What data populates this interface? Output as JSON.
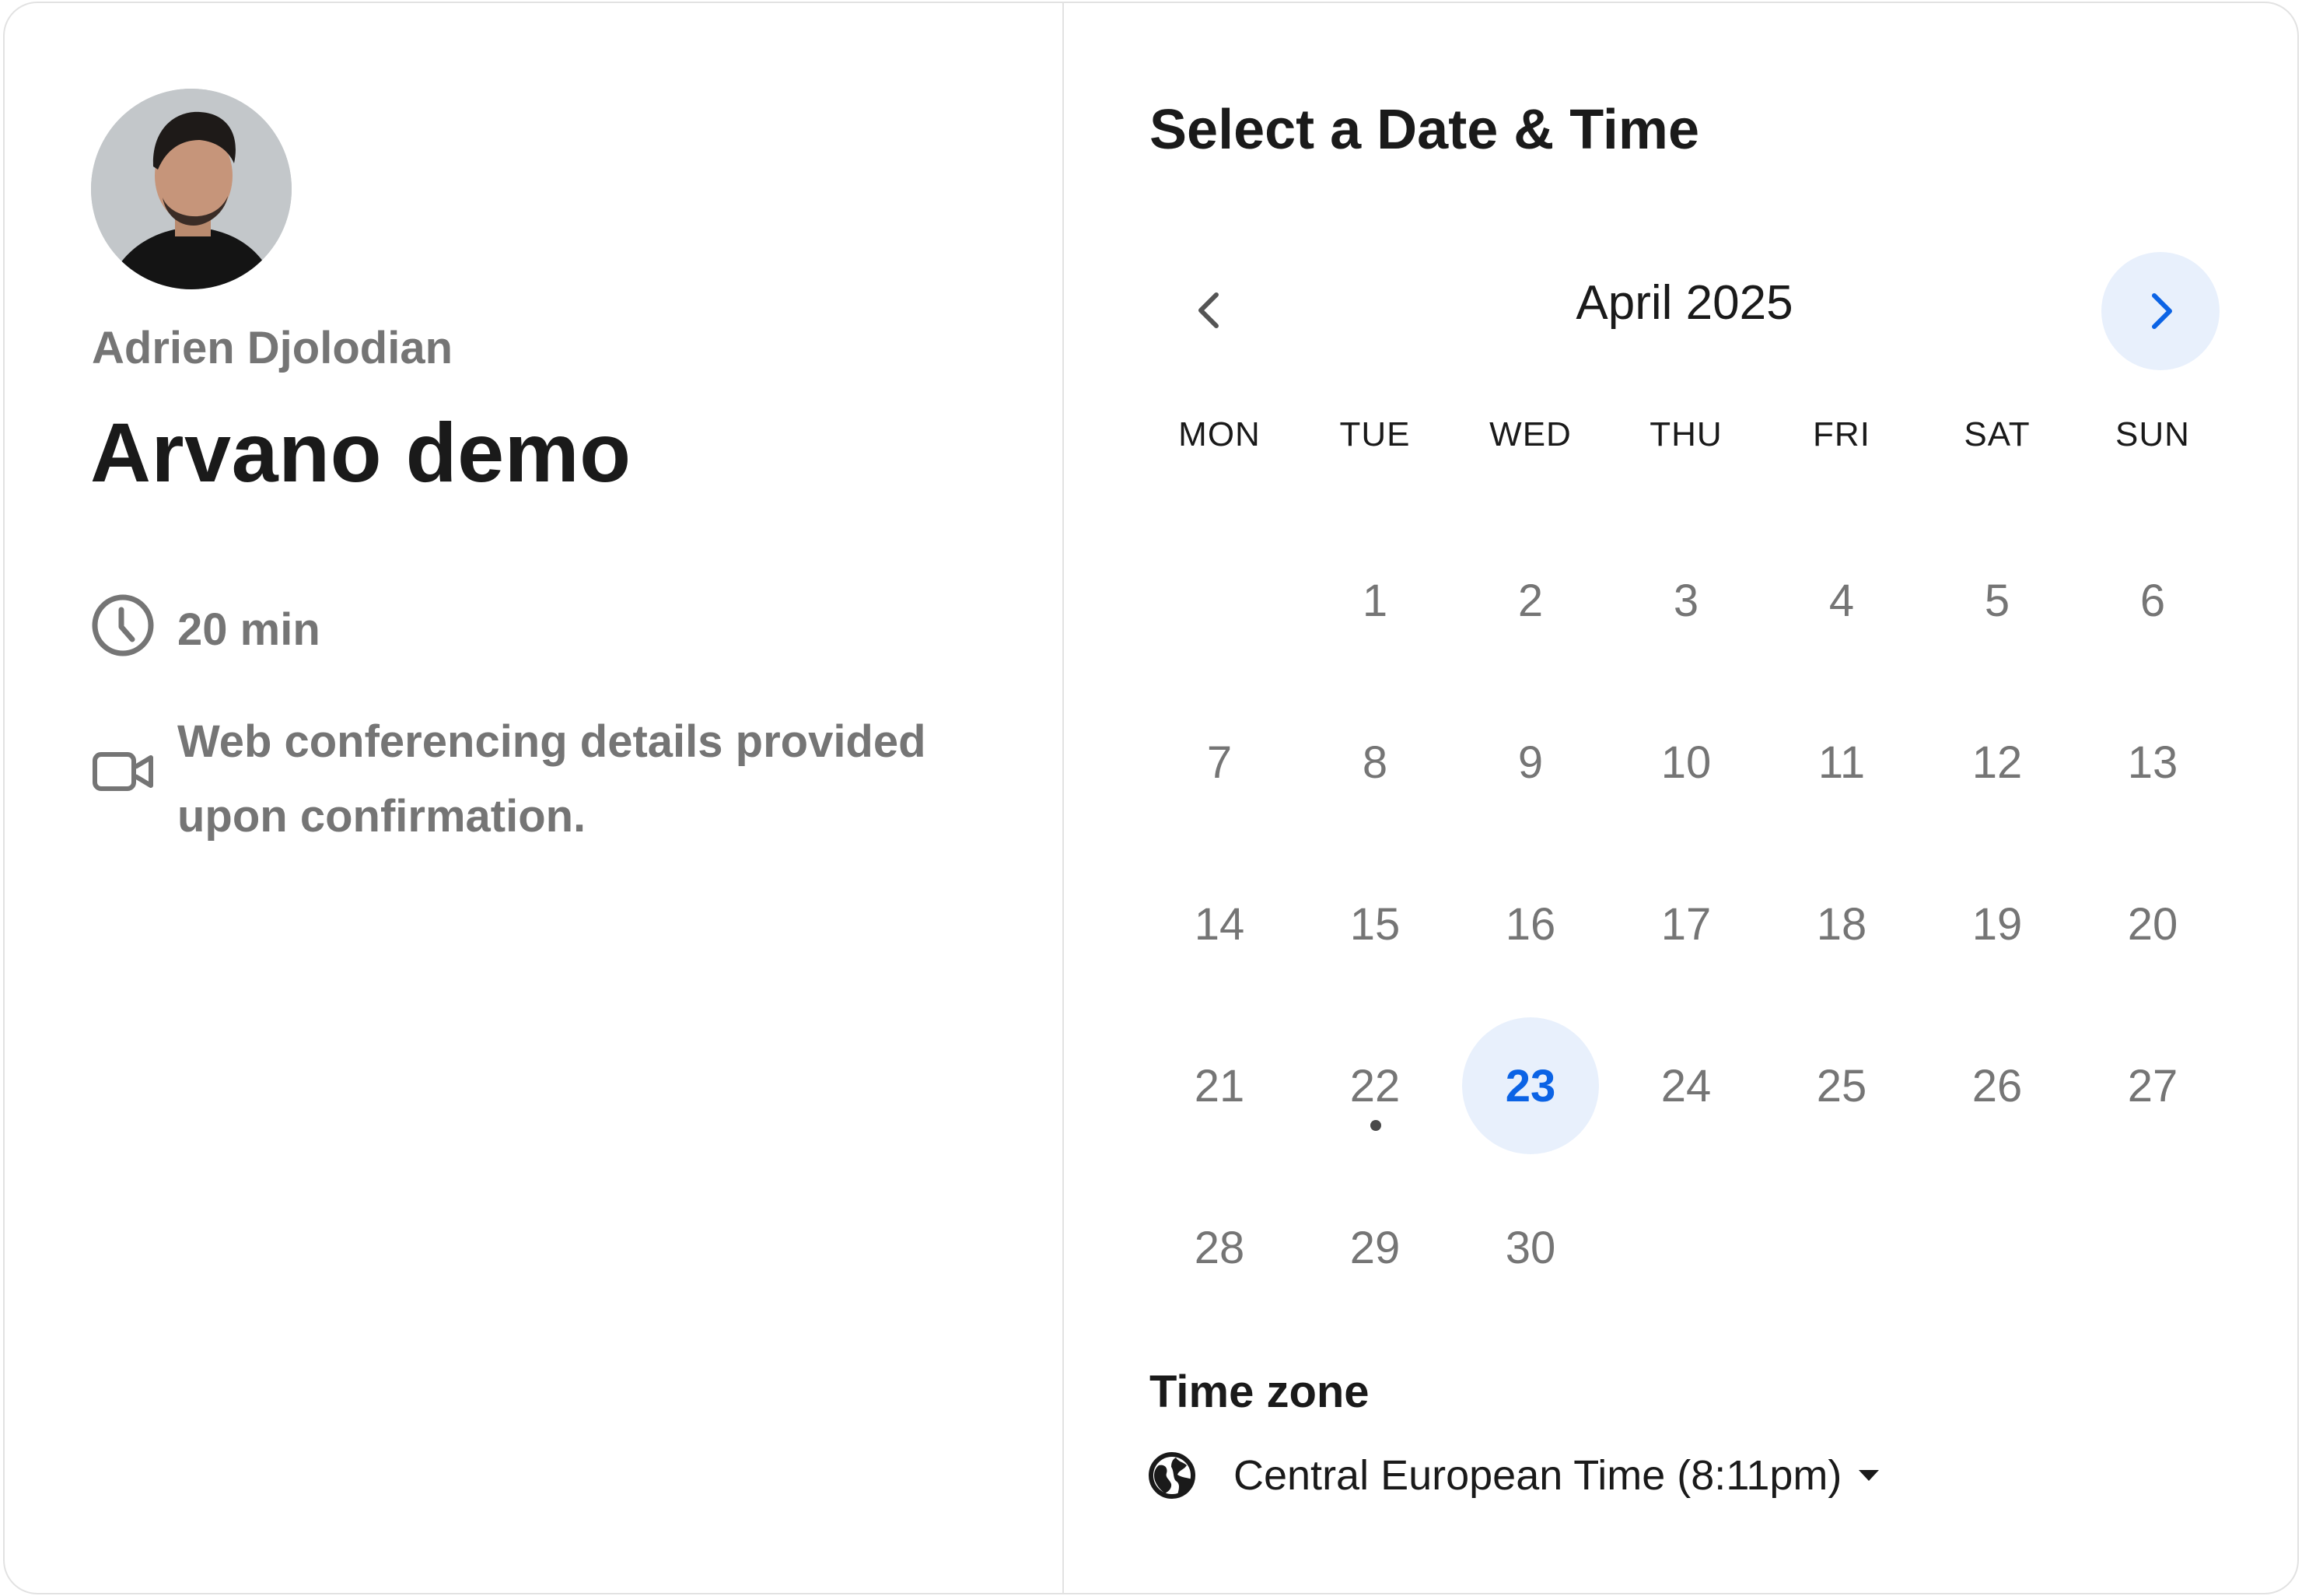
{
  "organizer": {
    "name": "Adrien Djolodian"
  },
  "event": {
    "title": "Arvano demo",
    "duration": "20 min",
    "conferencing": "Web conferencing details provided upon confirmation."
  },
  "calendar": {
    "heading": "Select a Date & Time",
    "month_label": "April 2025",
    "weekdays": [
      "MON",
      "TUE",
      "WED",
      "THU",
      "FRI",
      "SAT",
      "SUN"
    ],
    "first_weekday_offset": 1,
    "days": [
      "1",
      "2",
      "3",
      "4",
      "5",
      "6",
      "7",
      "8",
      "9",
      "10",
      "11",
      "12",
      "13",
      "14",
      "15",
      "16",
      "17",
      "18",
      "19",
      "20",
      "21",
      "22",
      "23",
      "24",
      "25",
      "26",
      "27",
      "28",
      "29",
      "30"
    ],
    "selected_day": "23",
    "today_marker_day": "22",
    "accent_color": "#0b63e5",
    "selected_bg": "#e8f0fc"
  },
  "timezone": {
    "title": "Time zone",
    "value": "Central European Time (8:11pm)"
  },
  "icons": {
    "duration": "clock-icon",
    "conferencing": "video-camera-icon",
    "prev": "chevron-left-icon",
    "next": "chevron-right-icon",
    "timezone": "globe-icon",
    "dropdown": "caret-down-icon"
  }
}
